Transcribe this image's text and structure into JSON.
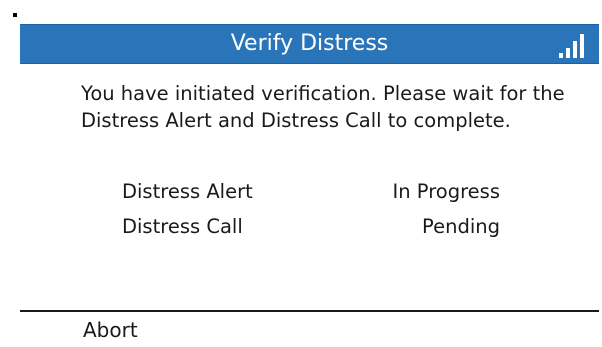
{
  "header": {
    "title": "Verify Distress",
    "signal_icon": "signal-strength-icon"
  },
  "message": "You have initiated verification. Please wait for the Distress Alert and Distress Call to complete.",
  "status": [
    {
      "label": "Distress Alert",
      "value": "In Progress"
    },
    {
      "label": "Distress Call",
      "value": "Pending"
    }
  ],
  "softkeys": {
    "left_label": "Abort"
  },
  "colors": {
    "title_bar": "#2a74ba",
    "title_text": "#ffffff",
    "text": "#1a1a1a"
  }
}
